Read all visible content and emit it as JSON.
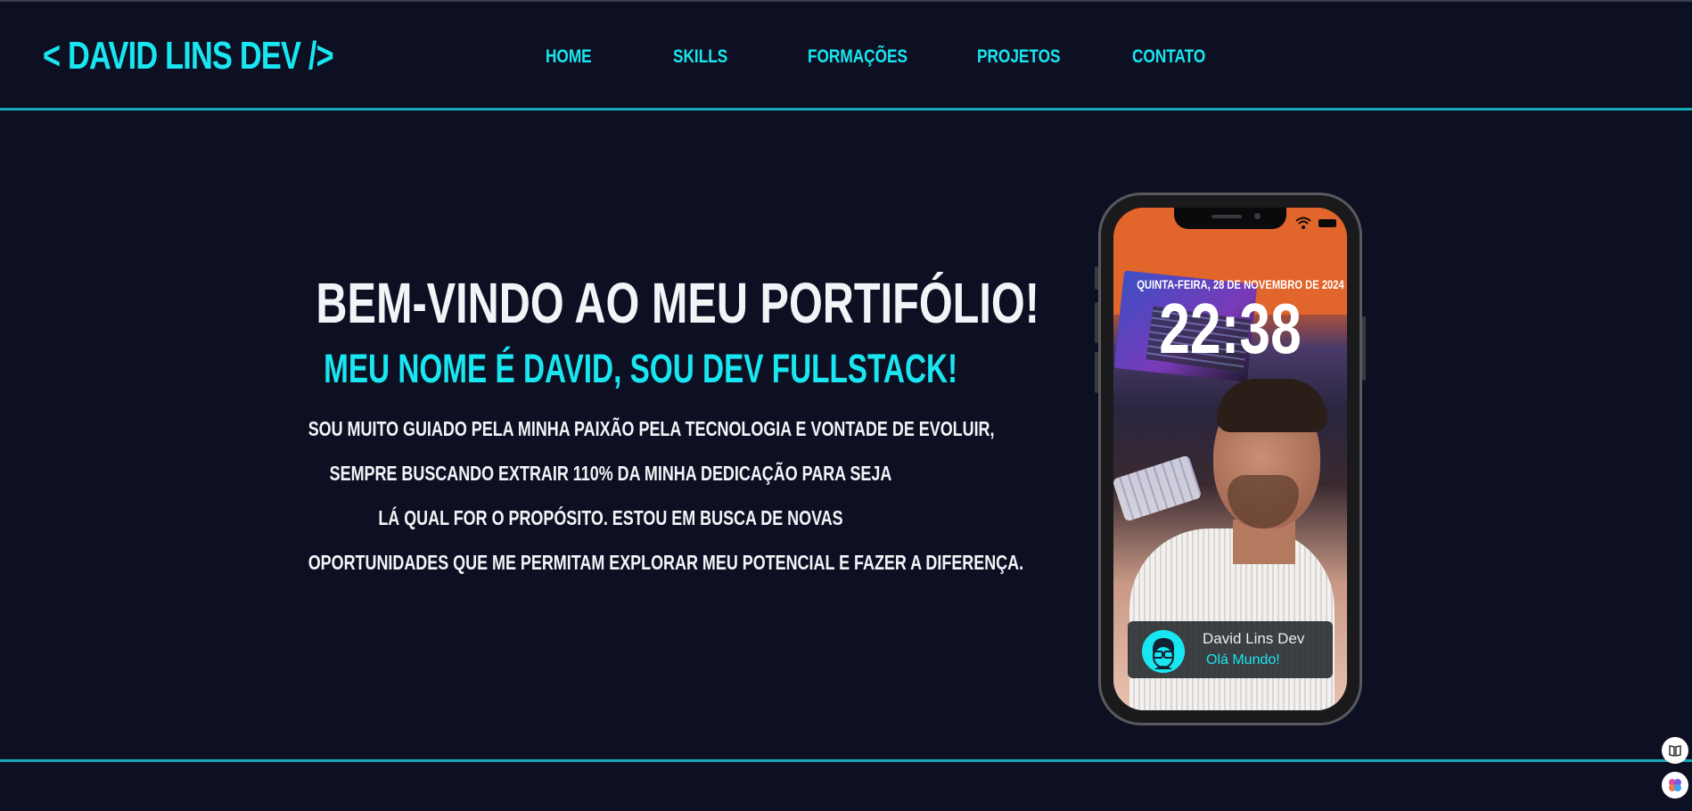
{
  "header": {
    "logo": "< DAVID LINS DEV />",
    "nav": [
      {
        "label": "HOME"
      },
      {
        "label": "SKILLS"
      },
      {
        "label": "FORMAÇÕES"
      },
      {
        "label": "PROJETOS"
      },
      {
        "label": "CONTATO"
      }
    ]
  },
  "hero": {
    "title": "BEM-VINDO AO MEU PORTIFÓLIO!",
    "subtitle": "MEU NOME É DAVID, SOU DEV FULLSTACK!",
    "lines": [
      "SOU MUITO GUIADO PELA MINHA PAIXÃO PELA TECNOLOGIA E VONTADE DE EVOLUIR,",
      "SEMPRE BUSCANDO EXTRAIR 110% DA MINHA DEDICAÇÃO PARA SEJA",
      "LÁ QUAL FOR O PROPÓSITO. ESTOU EM BUSCA DE NOVAS",
      "OPORTUNIDADES QUE ME PERMITAM EXPLORAR MEU POTENCIAL E FAZER A DIFERENÇA."
    ]
  },
  "phone": {
    "date": "QUINTA-FEIRA, 28 DE NOVEMBRO DE 2024",
    "time": "22:38",
    "notification": {
      "name": "David Lins Dev",
      "message": "Olá Mundo!"
    }
  },
  "colors": {
    "background": "#0d1022",
    "accent": "#19e6f0",
    "divider": "#17a9b8",
    "text": "#f2f4f8"
  }
}
